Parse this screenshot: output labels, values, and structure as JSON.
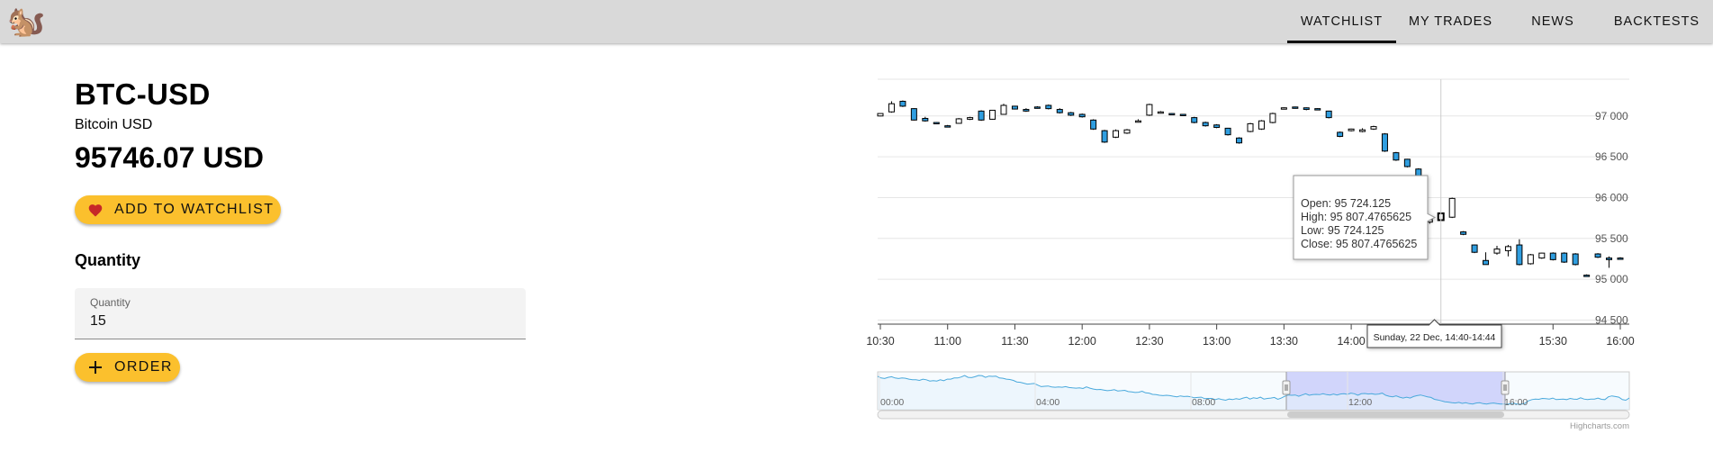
{
  "app": {
    "logo_icon": "squirrel-icon",
    "logo_glyph": "🐿️"
  },
  "nav": {
    "items": [
      {
        "label": "WATCHLIST",
        "active": true
      },
      {
        "label": "MY TRADES",
        "active": false
      },
      {
        "label": "NEWS",
        "active": false
      },
      {
        "label": "BACKTESTS",
        "active": false
      }
    ]
  },
  "asset": {
    "symbol": "BTC-USD",
    "name": "Bitcoin USD",
    "price": "95746.07 USD"
  },
  "watchlist_button": {
    "label": "ADD TO WATCHLIST",
    "icon": "heart-icon",
    "icon_color": "#c62828"
  },
  "quantity": {
    "heading": "Quantity",
    "field_label": "Quantity",
    "value": "15"
  },
  "order_button": {
    "label": "ORDER",
    "icon": "plus-icon"
  },
  "colors": {
    "accent": "#fbc02d",
    "down_candle": "#2f9ee0",
    "navigator_selection": "#ccd0fb",
    "navigator_line": "#4aa9dc"
  },
  "chart_data": {
    "type": "candlestick",
    "title": "",
    "x_ticks": [
      "10:30",
      "11:00",
      "11:30",
      "12:00",
      "12:30",
      "13:00",
      "13:30",
      "14:00",
      "14:30",
      "15:00",
      "15:30",
      "16:00"
    ],
    "y_ticks": [
      "97 000",
      "96 500",
      "96 000",
      "95 500",
      "95 000",
      "94 500"
    ],
    "ylim": [
      94450,
      97450
    ],
    "interval_minutes": 5,
    "candles": [
      {
        "t": "10:30",
        "o": 97000,
        "h": 97010,
        "c": 97030,
        "l": 96995
      },
      {
        "t": "10:35",
        "o": 97050,
        "h": 97180,
        "c": 97150,
        "l": 97040
      },
      {
        "t": "10:40",
        "o": 97180,
        "h": 97190,
        "c": 97120,
        "l": 97110
      },
      {
        "t": "10:45",
        "o": 97090,
        "h": 97095,
        "c": 96950,
        "l": 96945
      },
      {
        "t": "10:50",
        "o": 96970,
        "h": 96990,
        "c": 96940,
        "l": 96930
      },
      {
        "t": "10:55",
        "o": 96920,
        "h": 96925,
        "c": 96910,
        "l": 96905
      },
      {
        "t": "11:00",
        "o": 96880,
        "h": 96890,
        "c": 96870,
        "l": 96860
      },
      {
        "t": "11:05",
        "o": 96910,
        "h": 96975,
        "c": 96965,
        "l": 96905
      },
      {
        "t": "11:10",
        "o": 96960,
        "h": 96990,
        "c": 96980,
        "l": 96950
      },
      {
        "t": "11:15",
        "o": 97060,
        "h": 97070,
        "c": 96950,
        "l": 96940
      },
      {
        "t": "11:20",
        "o": 96960,
        "h": 97075,
        "c": 97070,
        "l": 96955
      },
      {
        "t": "11:25",
        "o": 97020,
        "h": 97150,
        "c": 97130,
        "l": 97015
      },
      {
        "t": "11:30",
        "o": 97120,
        "h": 97125,
        "c": 97085,
        "l": 97080
      },
      {
        "t": "11:35",
        "o": 97080,
        "h": 97095,
        "c": 97060,
        "l": 97050
      },
      {
        "t": "11:40",
        "o": 97110,
        "h": 97120,
        "c": 97100,
        "l": 97090
      },
      {
        "t": "11:45",
        "o": 97130,
        "h": 97140,
        "c": 97090,
        "l": 97080
      },
      {
        "t": "11:50",
        "o": 97080,
        "h": 97095,
        "c": 97040,
        "l": 97030
      },
      {
        "t": "11:55",
        "o": 97040,
        "h": 97050,
        "c": 97010,
        "l": 97000
      },
      {
        "t": "12:00",
        "o": 97020,
        "h": 97030,
        "c": 96990,
        "l": 96980
      },
      {
        "t": "12:05",
        "o": 96950,
        "h": 96960,
        "c": 96840,
        "l": 96830
      },
      {
        "t": "12:10",
        "o": 96820,
        "h": 96830,
        "c": 96680,
        "l": 96670
      },
      {
        "t": "12:15",
        "o": 96740,
        "h": 96835,
        "c": 96820,
        "l": 96730
      },
      {
        "t": "12:20",
        "o": 96790,
        "h": 96840,
        "c": 96830,
        "l": 96780
      },
      {
        "t": "12:25",
        "o": 96930,
        "h": 96960,
        "c": 96940,
        "l": 96920
      },
      {
        "t": "12:30",
        "o": 97010,
        "h": 97150,
        "c": 97140,
        "l": 97000
      },
      {
        "t": "12:35",
        "o": 97040,
        "h": 97060,
        "c": 97050,
        "l": 97030
      },
      {
        "t": "12:40",
        "o": 97030,
        "h": 97035,
        "c": 97020,
        "l": 97010
      },
      {
        "t": "12:45",
        "o": 97020,
        "h": 97025,
        "c": 97005,
        "l": 97000
      },
      {
        "t": "12:50",
        "o": 96980,
        "h": 96990,
        "c": 96920,
        "l": 96910
      },
      {
        "t": "12:55",
        "o": 96920,
        "h": 96930,
        "c": 96880,
        "l": 96870
      },
      {
        "t": "13:00",
        "o": 96890,
        "h": 96900,
        "c": 96860,
        "l": 96850
      },
      {
        "t": "13:05",
        "o": 96850,
        "h": 96855,
        "c": 96770,
        "l": 96760
      },
      {
        "t": "13:10",
        "o": 96730,
        "h": 96740,
        "c": 96670,
        "l": 96660
      },
      {
        "t": "13:15",
        "o": 96810,
        "h": 96915,
        "c": 96905,
        "l": 96800
      },
      {
        "t": "13:20",
        "o": 96840,
        "h": 96950,
        "c": 96940,
        "l": 96830
      },
      {
        "t": "13:25",
        "o": 96920,
        "h": 97040,
        "c": 97030,
        "l": 96910
      },
      {
        "t": "13:30",
        "o": 97090,
        "h": 97105,
        "c": 97100,
        "l": 97080
      },
      {
        "t": "13:35",
        "o": 97110,
        "h": 97115,
        "c": 97100,
        "l": 97090
      },
      {
        "t": "13:40",
        "o": 97100,
        "h": 97105,
        "c": 97080,
        "l": 97070
      },
      {
        "t": "13:45",
        "o": 97090,
        "h": 97095,
        "c": 97075,
        "l": 97070
      },
      {
        "t": "13:50",
        "o": 97060,
        "h": 97065,
        "c": 96980,
        "l": 96970
      },
      {
        "t": "13:55",
        "o": 96800,
        "h": 96810,
        "c": 96750,
        "l": 96740
      },
      {
        "t": "14:00",
        "o": 96820,
        "h": 96845,
        "c": 96840,
        "l": 96810
      },
      {
        "t": "14:05",
        "o": 96810,
        "h": 96850,
        "c": 96830,
        "l": 96800
      },
      {
        "t": "14:10",
        "o": 96840,
        "h": 96880,
        "c": 96870,
        "l": 96830
      },
      {
        "t": "14:15",
        "o": 96780,
        "h": 96790,
        "c": 96570,
        "l": 96560
      },
      {
        "t": "14:20",
        "o": 96550,
        "h": 96560,
        "c": 96460,
        "l": 96450
      },
      {
        "t": "14:25",
        "o": 96470,
        "h": 96475,
        "c": 96380,
        "l": 96370
      },
      {
        "t": "14:30",
        "o": 96350,
        "h": 96360,
        "c": 96160,
        "l": 96150
      },
      {
        "t": "14:35",
        "o": 95700,
        "h": 95740,
        "c": 95730,
        "l": 95680
      },
      {
        "t": "14:40",
        "o": 95724.125,
        "h": 95807.4765625,
        "c": 95807.4765625,
        "l": 95724.125
      },
      {
        "t": "14:45",
        "o": 95760,
        "h": 96000,
        "c": 95990,
        "l": 95750
      },
      {
        "t": "14:50",
        "o": 95580,
        "h": 95590,
        "c": 95550,
        "l": 95540
      },
      {
        "t": "14:55",
        "o": 95420,
        "h": 95425,
        "c": 95330,
        "l": 95320
      },
      {
        "t": "15:00",
        "o": 95230,
        "h": 95330,
        "c": 95180,
        "l": 95180
      },
      {
        "t": "15:05",
        "o": 95320,
        "h": 95410,
        "c": 95370,
        "l": 95300
      },
      {
        "t": "15:10",
        "o": 95350,
        "h": 95420,
        "c": 95400,
        "l": 95280
      },
      {
        "t": "15:15",
        "o": 95420,
        "h": 95490,
        "c": 95180,
        "l": 95170
      },
      {
        "t": "15:20",
        "o": 95190,
        "h": 95310,
        "c": 95300,
        "l": 95180
      },
      {
        "t": "15:25",
        "o": 95260,
        "h": 95325,
        "c": 95320,
        "l": 95250
      },
      {
        "t": "15:30",
        "o": 95320,
        "h": 95330,
        "c": 95240,
        "l": 95230
      },
      {
        "t": "15:35",
        "o": 95320,
        "h": 95330,
        "c": 95210,
        "l": 95200
      },
      {
        "t": "15:40",
        "o": 95310,
        "h": 95320,
        "c": 95180,
        "l": 95170
      },
      {
        "t": "15:45",
        "o": 95050,
        "h": 95060,
        "c": 95040,
        "l": 95030
      },
      {
        "t": "15:50",
        "o": 95310,
        "h": 95320,
        "c": 95270,
        "l": 95260
      },
      {
        "t": "15:55",
        "o": 95260,
        "h": 95280,
        "c": 95240,
        "l": 95140
      },
      {
        "t": "16:00",
        "o": 95260,
        "h": 95270,
        "c": 95250,
        "l": 95240
      }
    ],
    "hovered_index": 50,
    "tooltip": {
      "open": "Open: 95 724.125",
      "high": "High: 95 807.4765625",
      "low": "Low: 95 724.125",
      "close": "Close: 95 807.4765625"
    },
    "crosshair_label": "Sunday, 22 Dec, 14:40-14:44",
    "navigator": {
      "ticks": [
        "00:00",
        "04:00",
        "08:00",
        "12:00",
        "16:00"
      ],
      "series": [
        96750,
        96700,
        96680,
        96720,
        96740,
        96700,
        96680,
        96700,
        96690,
        96660,
        96640,
        96640,
        96620,
        96660,
        96640,
        96600,
        96610,
        96600,
        96640,
        96610,
        96660,
        96660,
        96700,
        96700,
        96730,
        96780,
        96720,
        96710,
        96740,
        96780,
        96770,
        96720,
        96760,
        96750,
        96760,
        96700,
        96690,
        96660,
        96650,
        96620,
        96570,
        96560,
        96530,
        96500,
        96510,
        96520,
        96470,
        96420,
        96430,
        96440,
        96410,
        96400,
        96410,
        96400,
        96420,
        96390,
        96380,
        96370,
        96380,
        96360,
        96410,
        96370,
        96340,
        96320,
        96330,
        96310,
        96290,
        96300,
        96320,
        96280,
        96290,
        96300,
        96260,
        96250,
        96230,
        96240,
        96270,
        96220,
        96210,
        96170,
        96160,
        96140,
        96130,
        96140,
        96130,
        96110,
        96090,
        96120,
        96100,
        96110,
        96090,
        96060,
        96070,
        96080,
        96030,
        96040,
        96040,
        96000,
        96030,
        96000,
        95980,
        96020,
        96000,
        96030,
        96010,
        96050,
        96080,
        96020,
        96060,
        96040,
        96080,
        96020,
        96040,
        96050,
        96070,
        96010,
        96050,
        96110,
        96150,
        96140,
        96150,
        96110,
        96150,
        96190,
        96140,
        96160,
        96170,
        96160,
        96190,
        96160,
        96150,
        96180,
        96150,
        96180,
        96190,
        96170,
        96210,
        96190,
        96140,
        96190,
        96200,
        96180,
        96190,
        96170,
        96180,
        96210,
        96140,
        96110,
        96090,
        96120,
        96080,
        96050,
        96080,
        96050,
        96100,
        96130,
        96150,
        96120,
        96090,
        96070,
        96010,
        95990,
        95960,
        95930,
        95920,
        95900,
        95890,
        95910,
        95880,
        95900,
        95870,
        95860,
        95890,
        95900,
        95870,
        95860,
        95880,
        95890,
        95870,
        95860,
        95860,
        95850,
        95870,
        95880,
        95850,
        95860,
        95880,
        95960,
        96000,
        96020,
        96010,
        96040,
        96030,
        96020,
        96050,
        96000,
        96010,
        96020,
        96000,
        96040,
        96020,
        96010,
        96060,
        96020,
        96000,
        96020,
        96020,
        96050,
        96010,
        96000,
        96090,
        96120,
        96100,
        96080,
        96000,
        95980,
        96050
      ],
      "selection_label_min": "",
      "selection_label_max": ""
    },
    "credit": "Highcharts.com"
  }
}
